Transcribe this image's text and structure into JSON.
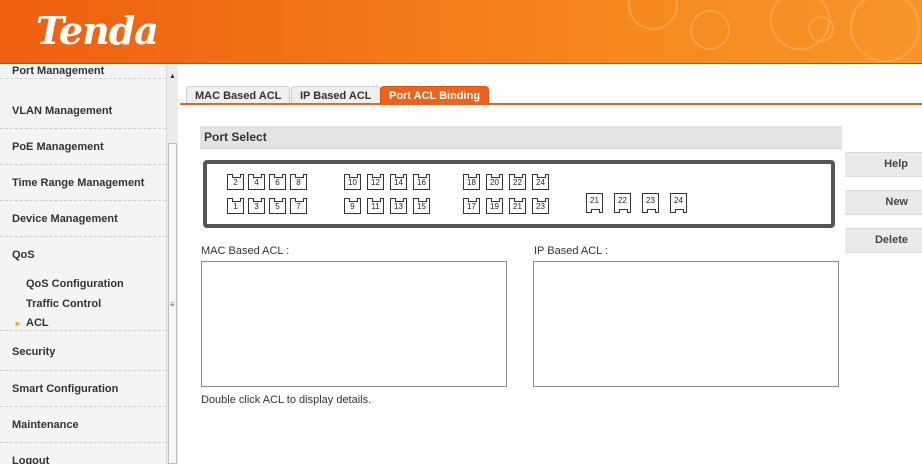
{
  "header": {
    "logo": "Tenda"
  },
  "sidebar": {
    "items": [
      {
        "label": "Port Management"
      },
      {
        "label": "VLAN Management"
      },
      {
        "label": "PoE Management"
      },
      {
        "label": "Time Range Management"
      },
      {
        "label": "Device Management"
      },
      {
        "label": "QoS"
      },
      {
        "label": "Security"
      },
      {
        "label": "Smart Configuration"
      },
      {
        "label": "Maintenance"
      },
      {
        "label": "Logout"
      }
    ],
    "qos_sub": [
      {
        "label": "QoS Configuration"
      },
      {
        "label": "Traffic Control"
      },
      {
        "label": "ACL"
      }
    ]
  },
  "tabs": [
    {
      "label": "MAC Based ACL"
    },
    {
      "label": "IP Based ACL"
    },
    {
      "label": "Port ACL Binding"
    }
  ],
  "port_select": {
    "title": "Port Select",
    "top_row": [
      "2",
      "4",
      "6",
      "8",
      "10",
      "12",
      "14",
      "16",
      "18",
      "20",
      "22",
      "24"
    ],
    "bottom_row": [
      "1",
      "3",
      "5",
      "7",
      "9",
      "11",
      "13",
      "15",
      "17",
      "19",
      "21",
      "23"
    ],
    "extra_ports": [
      "21",
      "22",
      "23",
      "24"
    ]
  },
  "buttons": {
    "help": "Help",
    "new": "New",
    "delete": "Delete"
  },
  "acl": {
    "mac_label": "MAC Based ACL :",
    "ip_label": "IP Based ACL :",
    "hint": "Double click ACL to display details."
  },
  "colors": {
    "accent": "#f0621a",
    "active_marker": "#f3a800"
  }
}
